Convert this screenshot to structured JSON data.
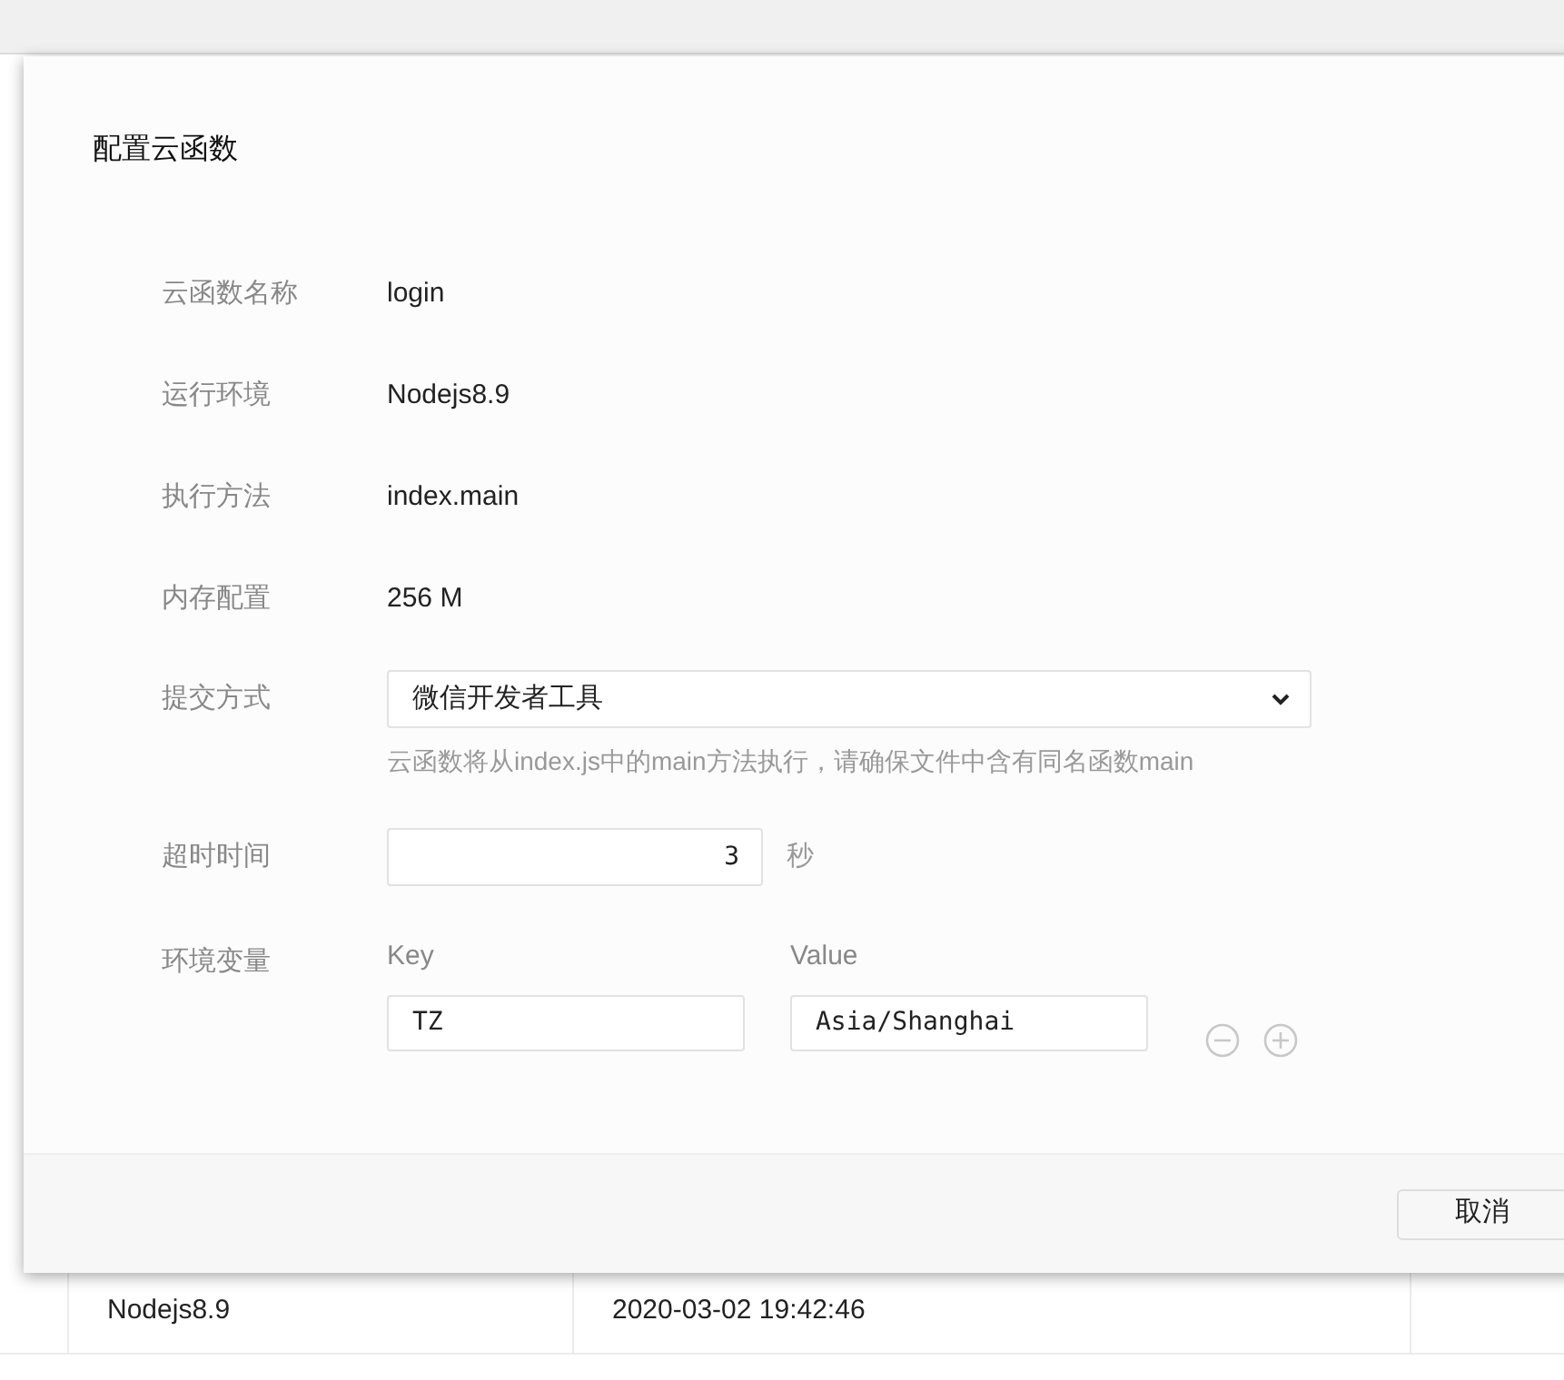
{
  "background": {
    "row": {
      "runtime": "Nodejs8.9",
      "time": "2020-03-02 19:42:46"
    }
  },
  "dialog": {
    "title": "配置云函数",
    "fields": [
      {
        "kind": "text",
        "label": "云函数名称",
        "value": "login"
      },
      {
        "kind": "text",
        "label": "运行环境",
        "value": "Nodejs8.9"
      },
      {
        "kind": "text",
        "label": "执行方法",
        "value": "index.main"
      },
      {
        "kind": "text",
        "label": "内存配置",
        "value": "256 M"
      },
      {
        "kind": "select",
        "label": "提交方式",
        "value": "微信开发者工具",
        "hint": "云函数将从index.js中的main方法执行，请确保文件中含有同名函数main"
      },
      {
        "kind": "number",
        "label": "超时时间",
        "value": "3",
        "unit": "秒"
      },
      {
        "kind": "env",
        "label": "环境变量",
        "key_header": "Key",
        "value_header": "Value",
        "pairs": [
          {
            "key": "TZ",
            "value": "Asia/Shanghai"
          }
        ]
      }
    ],
    "buttons": [
      "取消"
    ]
  }
}
